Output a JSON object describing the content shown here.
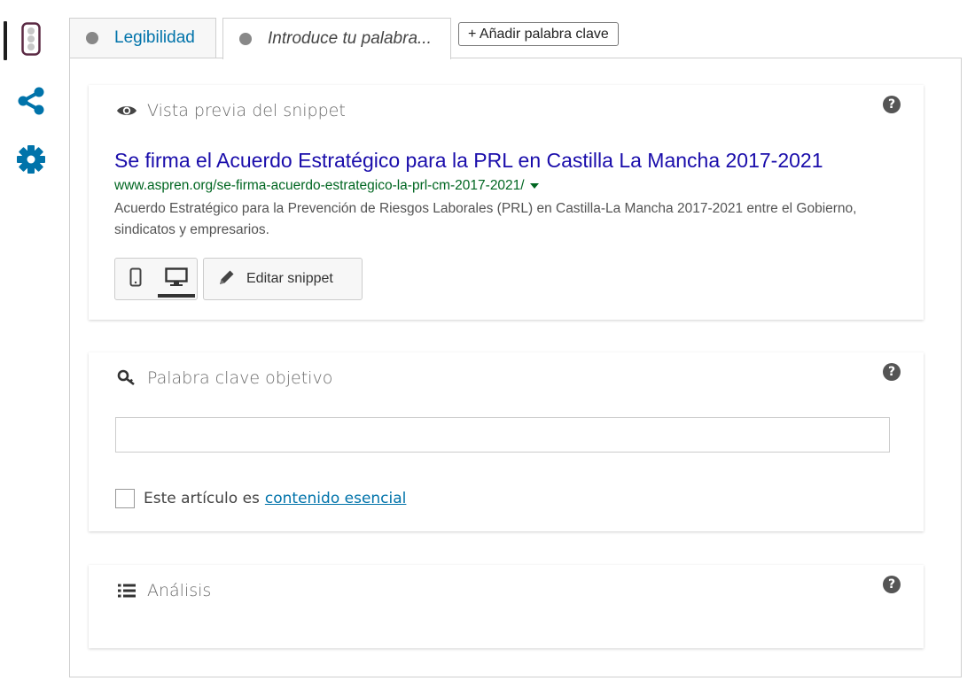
{
  "colors": {
    "accent": "#0073aa",
    "snippet_title": "#1a0dab",
    "snippet_url": "#006621",
    "snippet_desc": "#545454",
    "score_dot": "#888888",
    "traffic_light": "#5b2a44"
  },
  "sidebar": {
    "items": [
      {
        "icon": "traffic-light-icon",
        "active": true
      },
      {
        "icon": "share-icon",
        "active": false
      },
      {
        "icon": "gear-icon",
        "active": false
      }
    ]
  },
  "tabs": [
    {
      "label": "Legibilidad",
      "icon": "score-dot-icon",
      "active": false
    },
    {
      "label": "Introduce tu palabra...",
      "icon": "score-dot-icon",
      "active": true
    }
  ],
  "add_keyword_label": "+ Añadir palabra clave",
  "snippet": {
    "header": "Vista previa del snippet",
    "header_icon": "eye-icon",
    "help_glyph": "?",
    "title": "Se firma el Acuerdo Estratégico para la PRL en Castilla La Mancha 2017-2021",
    "url": "www.aspren.org/se-firma-acuerdo-estrategico-la-prl-cm-2017-2021/",
    "description": "Acuerdo Estratégico para la Prevención de Riesgos Laborales (PRL) en Castilla-La Mancha 2017-2021 entre el Gobierno, sindicatos y empresarios.",
    "modes": [
      {
        "icon": "mobile-icon",
        "selected": false
      },
      {
        "icon": "desktop-icon",
        "selected": true
      }
    ],
    "edit_label": "Editar snippet",
    "edit_icon": "pencil-icon"
  },
  "focus": {
    "header": "Palabra clave objetivo",
    "header_icon": "key-icon",
    "help_glyph": "?",
    "input_value": "",
    "cornerstone_text": "Este artículo es",
    "cornerstone_link": "contenido esencial",
    "cornerstone_checked": false
  },
  "analysis": {
    "header": "Análisis",
    "header_icon": "list-icon",
    "help_glyph": "?"
  }
}
